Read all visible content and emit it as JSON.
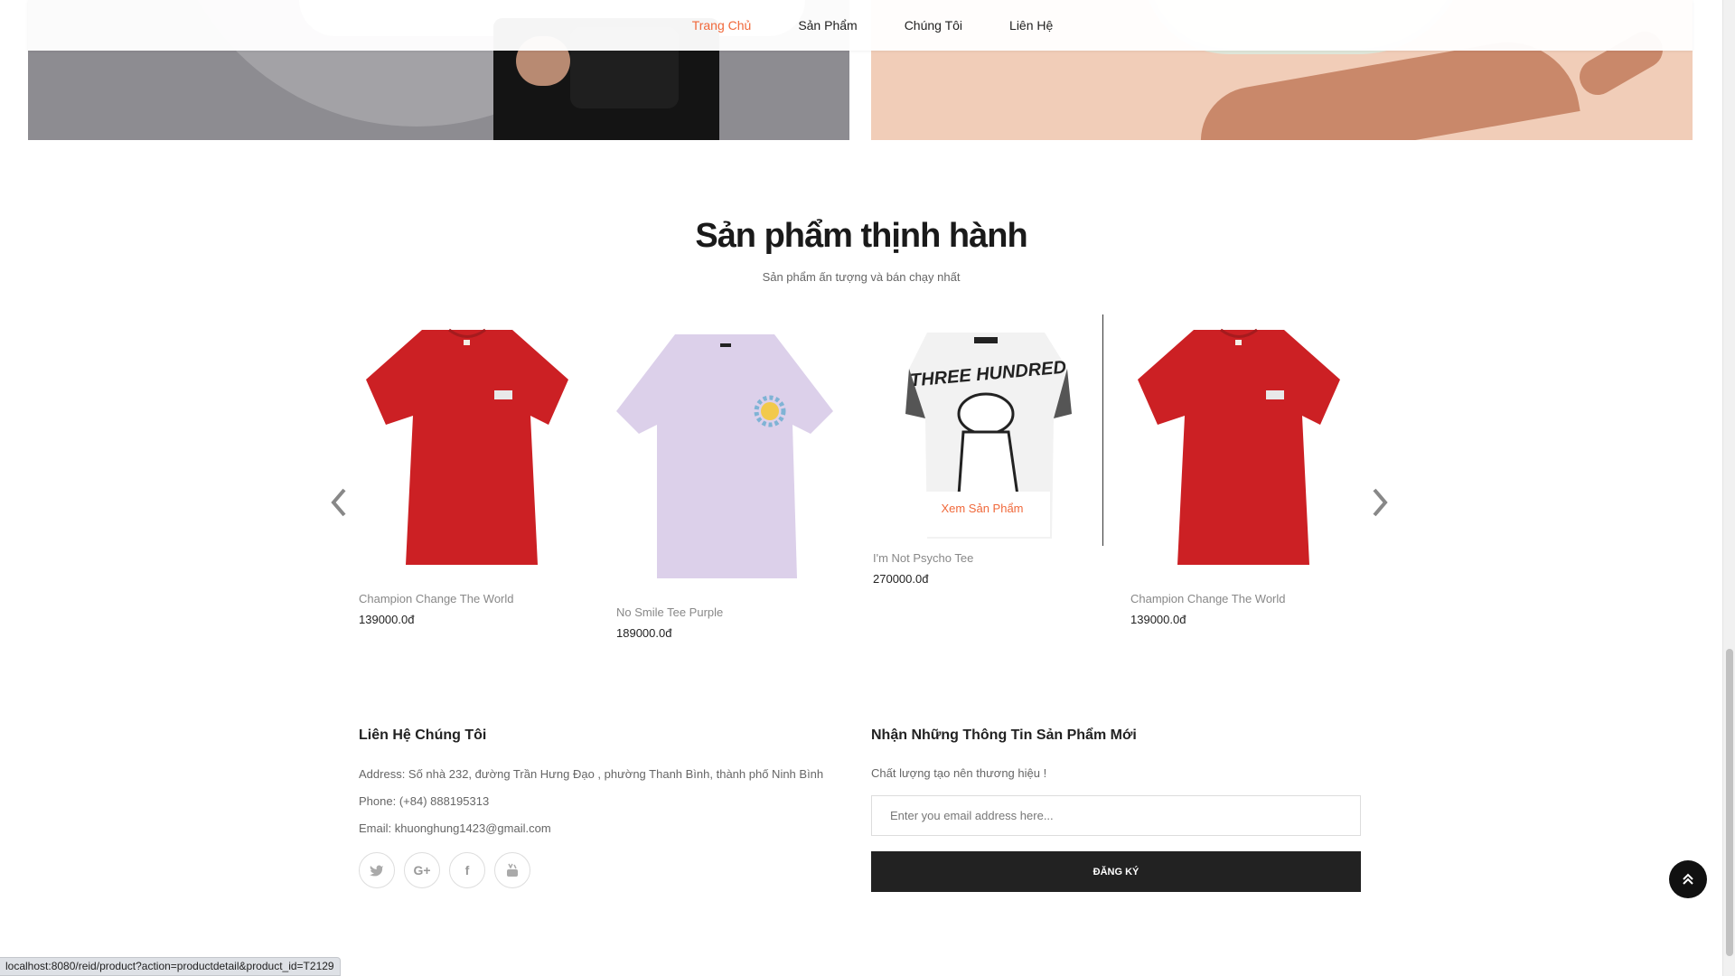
{
  "nav": {
    "items": [
      {
        "label": "Trang Chủ",
        "active": true
      },
      {
        "label": "Sản Phẩm",
        "active": false
      },
      {
        "label": "Chúng Tôi",
        "active": false
      },
      {
        "label": "Liên Hệ",
        "active": false
      }
    ],
    "active_color": "#f0683a"
  },
  "trending": {
    "title": "Sản phẩm thịnh hành",
    "subtitle": "Sản phẩm ấn tượng và bán chạy nhất",
    "products": [
      {
        "name": "Champion Change The World",
        "price": "139000.0đ",
        "color": "#cc2024"
      },
      {
        "name": "No Smile Tee Purple",
        "price": "189000.0đ",
        "color": "#dcd0ea"
      },
      {
        "name": "I'm Not Psycho Tee",
        "price": "270000.0đ",
        "color": "#f2f2f2",
        "print_text": "THREE HUNDRED",
        "overlay_label": "Xem Sản Phẩm"
      },
      {
        "name": "Champion Change The World",
        "price": "139000.0đ",
        "color": "#cc2024"
      }
    ]
  },
  "footer": {
    "contact_title": "Liên Hệ Chúng Tôi",
    "address": "Address: Số nhà 232, đường Trần Hưng Đạo , phường Thanh Bình, thành phố Ninh Bình",
    "phone": "Phone: (+84) 888195313",
    "email": "Email: khuonghung1423@gmail.com",
    "socials": [
      "twitter-icon",
      "google-plus-icon",
      "facebook-icon",
      "youtube-icon"
    ],
    "newsletter_title": "Nhận Những Thông Tin Sản Phẩm Mới",
    "newsletter_text": "Chất lượng tạo nên thương hiệu !",
    "email_placeholder": "Enter you email address here...",
    "subscribe_label": "ĐĂNG KÝ"
  },
  "status_url": "localhost:8080/reid/product?action=productdetail&product_id=T2129"
}
